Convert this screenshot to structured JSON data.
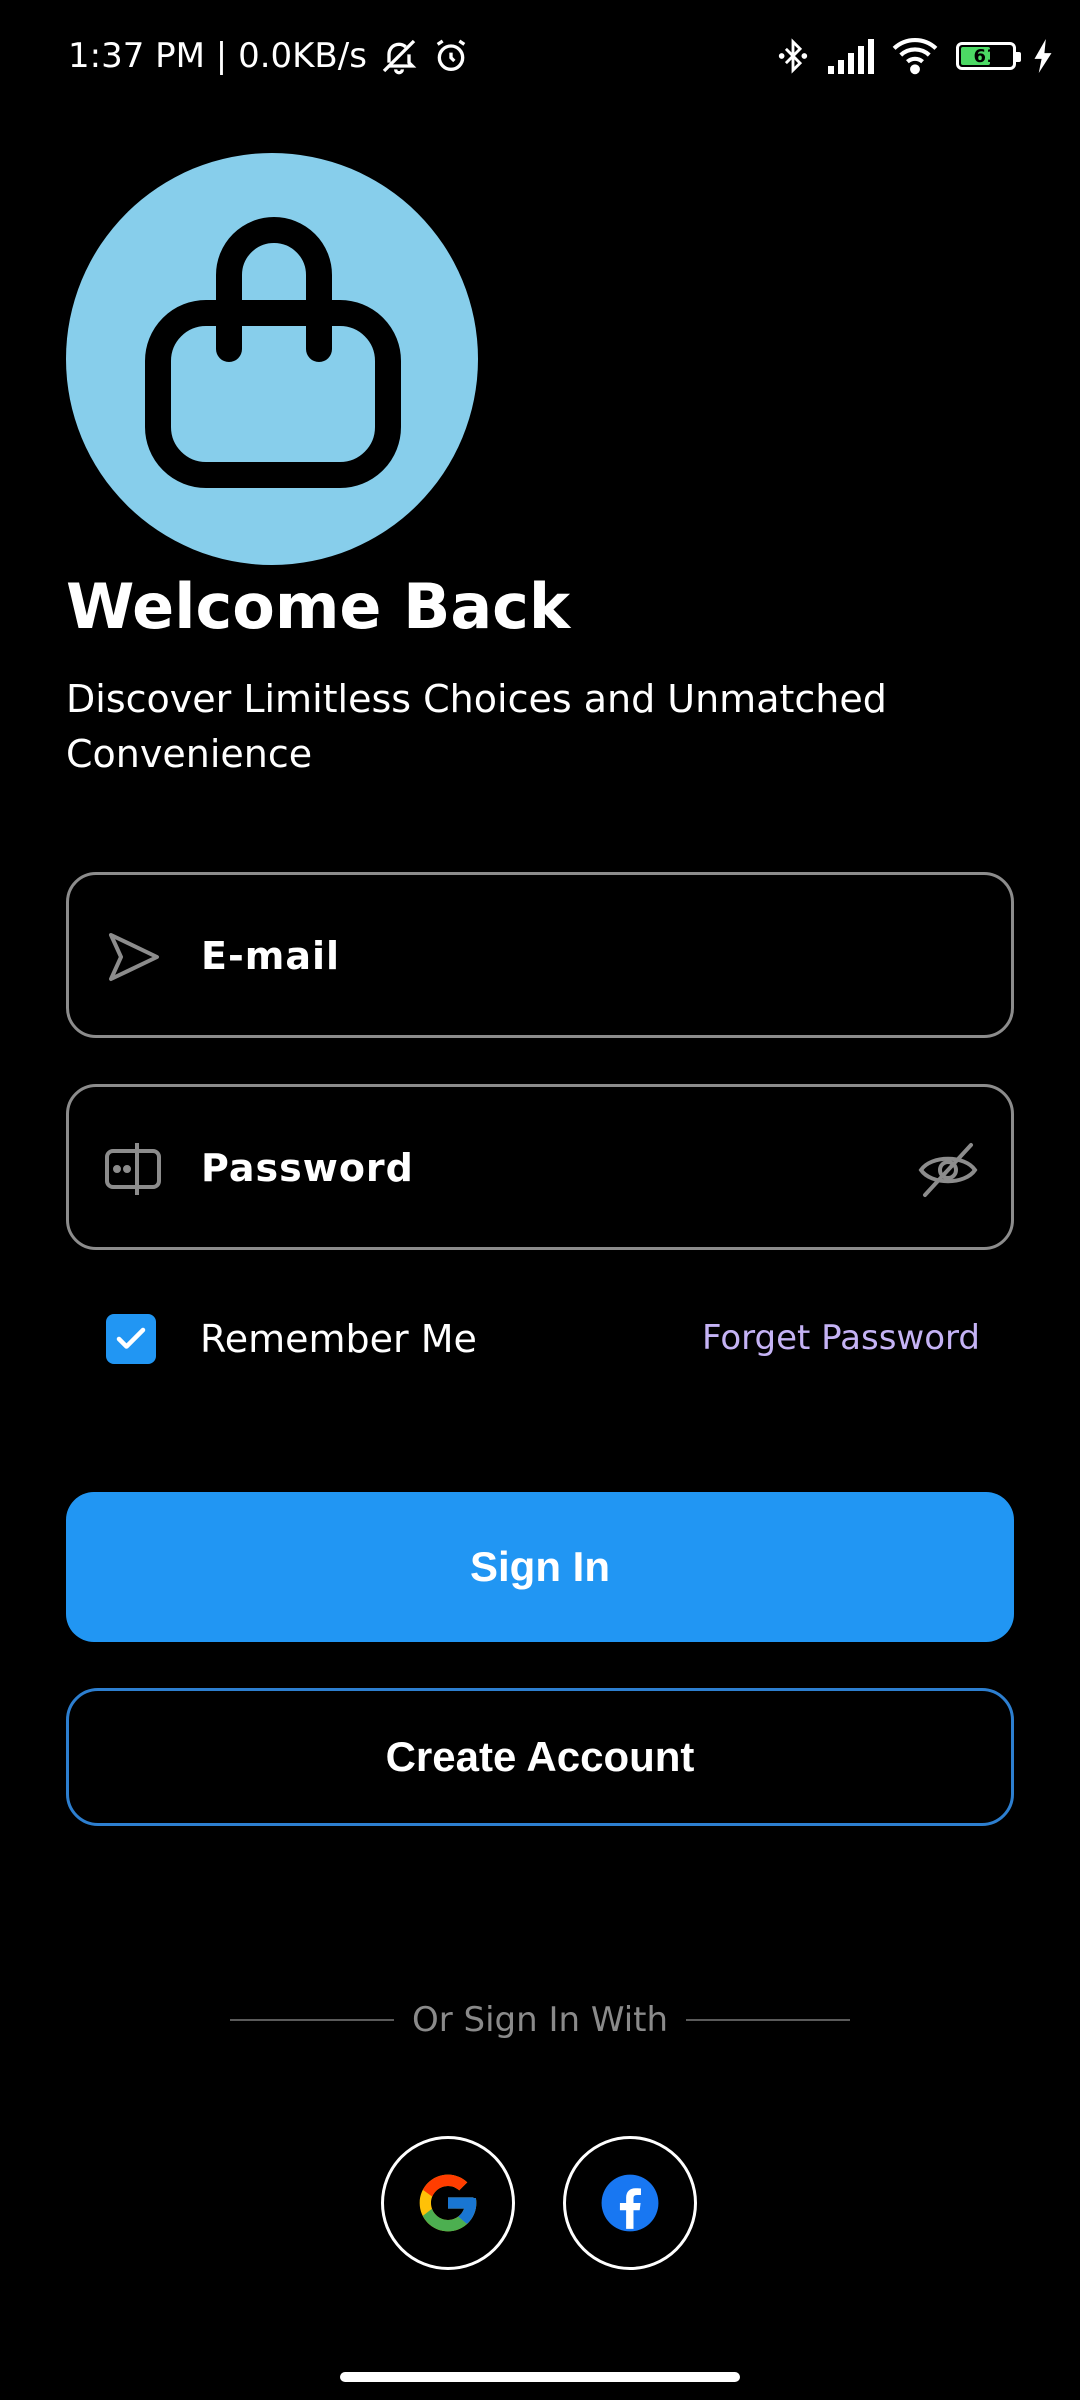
{
  "status_bar": {
    "time_text": "1:37 PM | 0.0KB/s",
    "battery_level": "61",
    "icons": [
      "mute-notification-icon",
      "alarm-icon",
      "bluetooth-icon",
      "signal-icon",
      "wifi-icon",
      "battery-icon",
      "charging-icon"
    ]
  },
  "header": {
    "title": "Welcome Back",
    "subtitle": "Discover Limitless Choices and Unmatched Convenience"
  },
  "form": {
    "email_placeholder": "E-mail",
    "email_value": "",
    "password_placeholder": "Password",
    "password_value": "",
    "remember_label": "Remember Me",
    "remember_checked": true,
    "forget_label": "Forget Password"
  },
  "actions": {
    "sign_in_label": "Sign In",
    "create_account_label": "Create Account"
  },
  "social": {
    "divider_text": "Or Sign In With",
    "providers": [
      "google-icon",
      "facebook-icon"
    ]
  },
  "colors": {
    "background": "#000000",
    "accent": "#2196f3",
    "logo_bg": "#87ceeb",
    "link": "#c5b3f5"
  }
}
